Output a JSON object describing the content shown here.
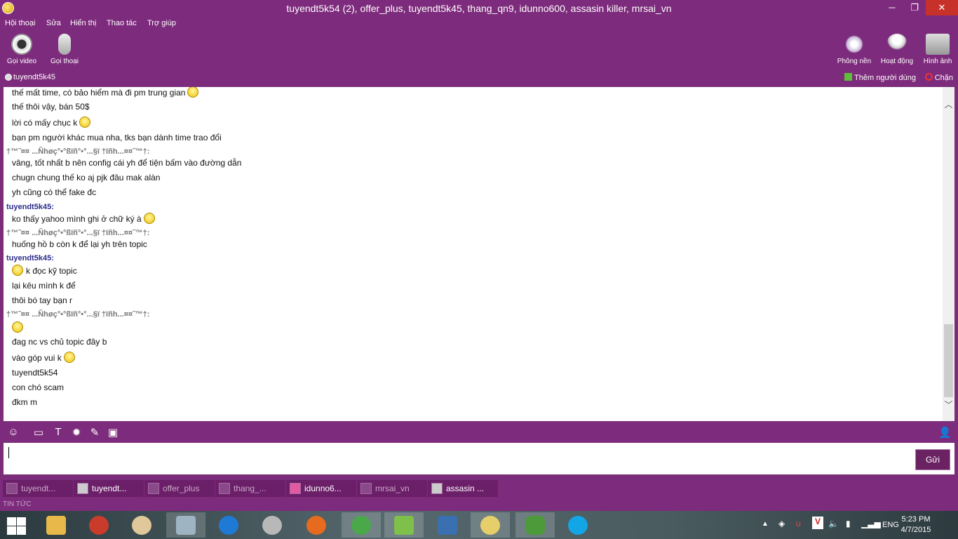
{
  "window": {
    "title": "tuyendt5k54 (2), offer_plus, tuyendt5k45, thang_qn9, idunno600, assasin killer, mrsai_vn",
    "min_glyph": "─",
    "max_glyph": "❐",
    "close_glyph": "✕"
  },
  "menu": [
    "Hội thoại",
    "Sửa",
    "Hiển thị",
    "Thao tác",
    "Trợ giúp"
  ],
  "toolbar": {
    "video_call": "Gọi video",
    "voice_call": "Gọi thoại",
    "theme": "Phông nền",
    "activity": "Hoạt động",
    "photos": "Hình ảnh"
  },
  "status": {
    "contact": "tuyendt5k45",
    "add_user": "Thêm người dùng",
    "block": "Chặn"
  },
  "messages": [
    {
      "text": "thế mất time, có bảo hiểm mà đi pm trung gian",
      "smiley": true
    },
    {
      "text": "thế thôi vậy, bán 50$"
    },
    {
      "text": "lời có mấy chục k",
      "smiley": true
    },
    {
      "text": "bạn pm người khác mua nha, tks bạn dành time trao đổi"
    },
    {
      "sender": "†™˜¤¤ ...Ñhøç°•°ßïñ°•°...§ï †ïñh...¤¤˜™†:",
      "style": "gray"
    },
    {
      "text": "vâng, tốt nhất b nên config cái yh để tiện bấm vào đường dẫn"
    },
    {
      "text": "chugn chung thế ko aj pjk đâu mak alàn"
    },
    {
      "text": "yh cũng có thể fake đc"
    },
    {
      "sender": "tuyendt5k45:",
      "style": "blue"
    },
    {
      "text": "ko thấy yahoo mình ghi ở chữ ký à",
      "smiley": true
    },
    {
      "sender": "†™˜¤¤ ...Ñhøç°•°ßïñ°•°...§ï †ïñh...¤¤˜™†:",
      "style": "gray"
    },
    {
      "text": "huống hồ b còn k để lại yh trên topic"
    },
    {
      "sender": "tuyendt5k45:",
      "style": "blue"
    },
    {
      "text": "k đọc kỹ topic",
      "smiley_lead": true
    },
    {
      "text": "lại kêu mình k để"
    },
    {
      "text": "thôi bó tay bạn r"
    },
    {
      "sender": "†™˜¤¤ ...Ñhøç°•°ßïñ°•°...§ï †ïñh...¤¤˜™†:",
      "style": "gray"
    },
    {
      "text": "",
      "smiley_lead": true
    },
    {
      "text": "đag nc vs chủ topic đây b"
    },
    {
      "text": "vào góp vui k",
      "smiley": true
    },
    {
      "text": "tuyendt5k54"
    },
    {
      "text": "con chó scam"
    },
    {
      "text": "đkm m"
    }
  ],
  "format_icons": [
    "smiley-icon",
    "wink-icon",
    "font-icon",
    "buzz-icon",
    "attach-icon",
    "screen-icon"
  ],
  "send_label": "Gửi",
  "tabs": [
    {
      "label": "tuyendt...",
      "active": false
    },
    {
      "label": "tuyendt...",
      "active": true
    },
    {
      "label": "offer_plus",
      "active": false
    },
    {
      "label": "thang_...",
      "active": false
    },
    {
      "label": "idunno6...",
      "active": true,
      "pink": true
    },
    {
      "label": "mrsai_vn",
      "active": false
    },
    {
      "label": "assasin ...",
      "active": true
    }
  ],
  "news_label": "TIN TỨC",
  "taskbar": {
    "language": "ENG",
    "time": "5:23 PM",
    "date": "4/7/2015"
  },
  "colors": {
    "chrome": "#7d2b7c",
    "send_button": "#6b2262",
    "sender_blue": "#2b2b8c"
  }
}
